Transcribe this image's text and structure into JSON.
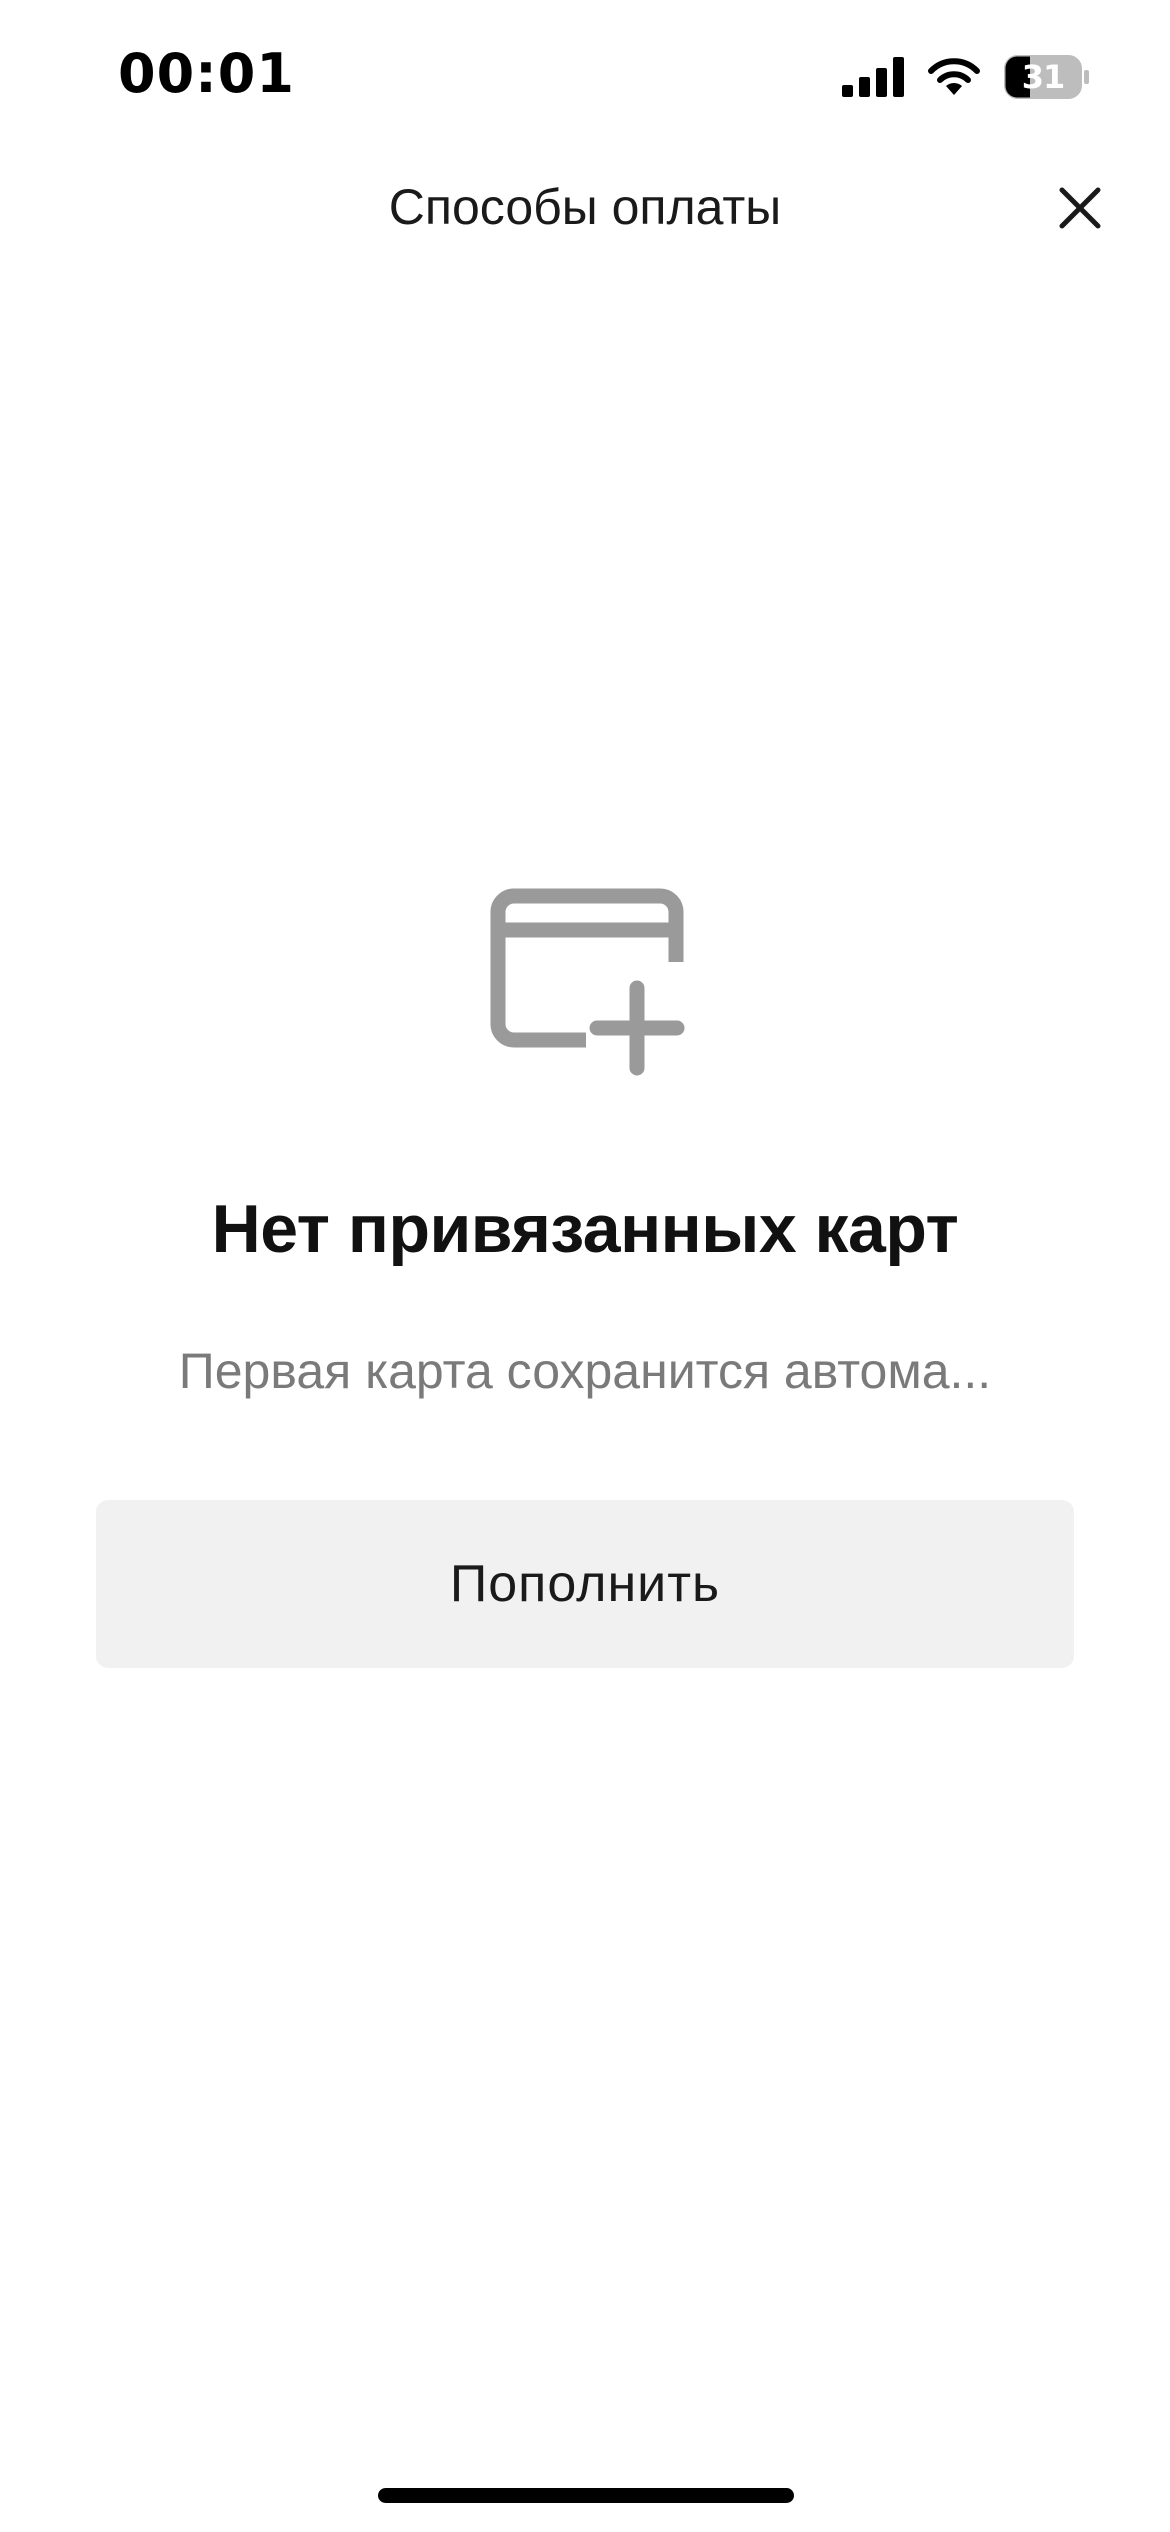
{
  "status_bar": {
    "time": "00:01",
    "battery_level": "31",
    "icons": [
      "signal-icon",
      "wifi-icon",
      "battery-icon"
    ]
  },
  "nav": {
    "title": "Способы оплаты",
    "close_icon": "close-icon"
  },
  "empty_state": {
    "icon": "card-add-icon",
    "title": "Нет привязанных карт",
    "subtitle": "Первая карта сохранится автома...",
    "topup_label": "Пополнить"
  },
  "colors": {
    "icon_gray": "#9a9a9a",
    "button_bg": "#f1f1f1",
    "subtitle_gray": "#7a7a7a"
  }
}
